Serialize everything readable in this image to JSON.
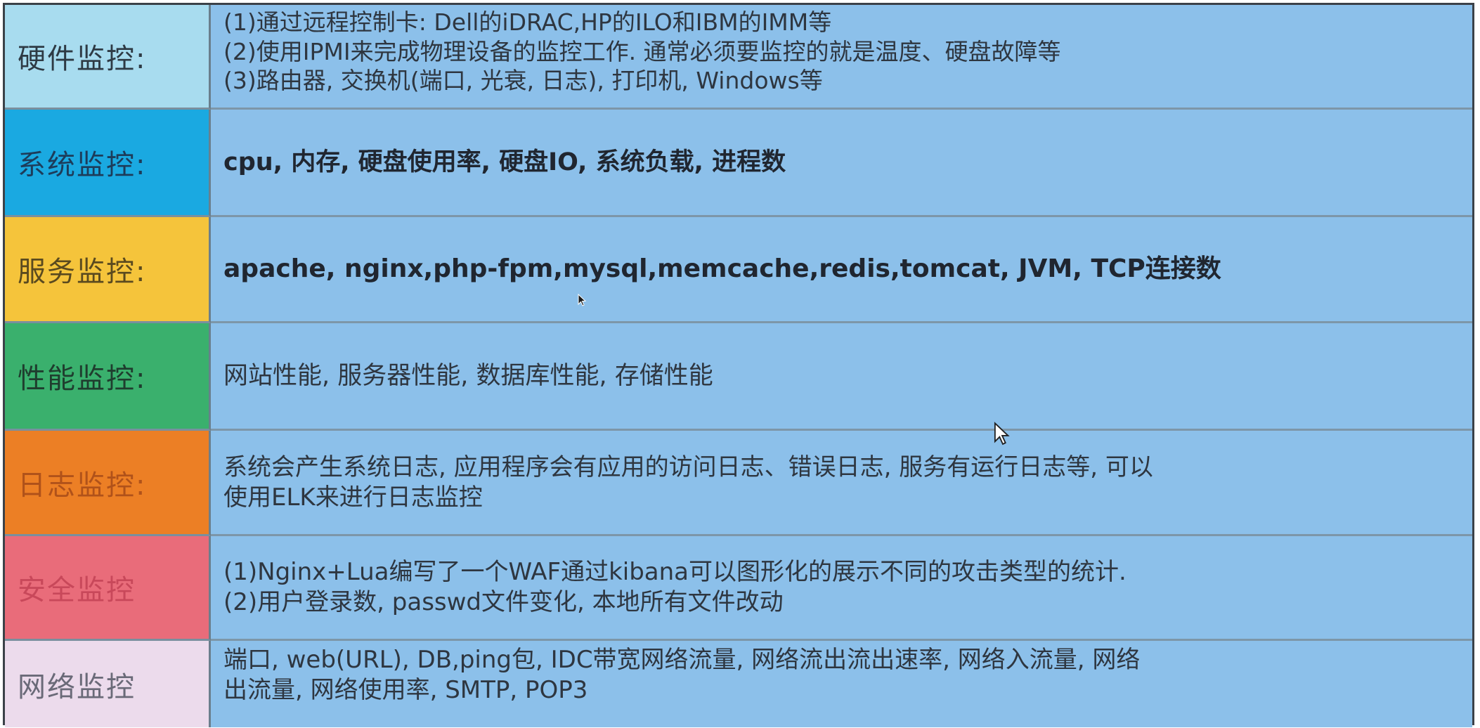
{
  "rows": [
    {
      "label": "硬件监控:",
      "label_bg": "#a8dcef",
      "label_color": "#2e3a44",
      "lines": [
        "(1)通过远程控制卡: Dell的iDRAC,HP的ILO和IBM的IMM等",
        "(2)使用IPMI来完成物理设备的监控工作. 通常必须要监控的就是温度、硬盘故障等",
        "(3)路由器, 交换机(端口, 光衰, 日志), 打印机, Windows等"
      ]
    },
    {
      "label": "系统监控:",
      "label_bg": "#1aa9e1",
      "label_color": "#1d3c5a",
      "lines": [
        "cpu, 内存, 硬盘使用率, 硬盘IO, 系统负载, 进程数"
      ]
    },
    {
      "label": "服务监控:",
      "label_bg": "#f5c43b",
      "label_color": "#5a4a1f",
      "lines": [
        "apache, nginx,php-fpm,mysql,memcache,redis,tomcat, JVM, TCP连接数"
      ]
    },
    {
      "label": "性能监控:",
      "label_bg": "#3ab06d",
      "label_color": "#1f3d2e",
      "lines": [
        "网站性能, 服务器性能, 数据库性能, 存储性能"
      ]
    },
    {
      "label": "日志监控:",
      "label_bg": "#ec7f25",
      "label_color": "#b0521a",
      "lines": [
        "系统会产生系统日志, 应用程序会有应用的访问日志、错误日志, 服务有运行日志等, 可以",
        "使用ELK来进行日志监控"
      ]
    },
    {
      "label": "安全监控",
      "label_bg": "#e96c7a",
      "label_color": "#c8485a",
      "lines": [
        "(1)Nginx+Lua编写了一个WAF通过kibana可以图形化的展示不同的攻击类型的统计.",
        "(2)用户登录数, passwd文件变化, 本地所有文件改动"
      ]
    },
    {
      "label": "网络监控",
      "label_bg": "#ecdbec",
      "label_color": "#6a6a78",
      "lines": [
        "端口, web(URL), DB,ping包, IDC带宽网络流量, 网络流出流出速率, 网络入流量, 网络",
        "出流量, 网络使用率, SMTP, POP3"
      ]
    }
  ],
  "colors": {
    "content_bg": "#8cc0ea",
    "border": "#3b4148"
  }
}
